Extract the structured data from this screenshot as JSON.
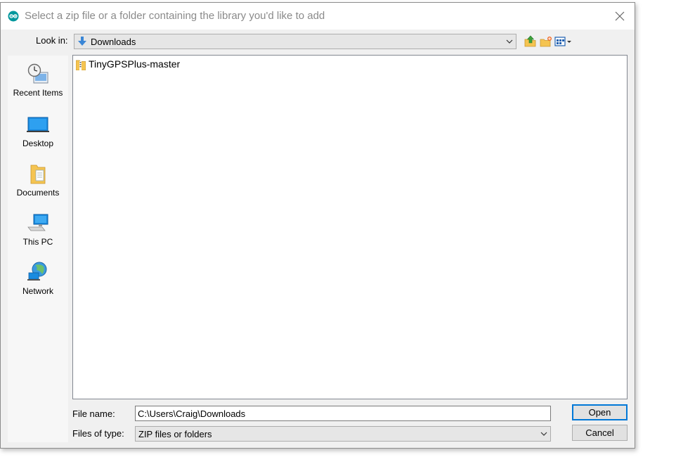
{
  "window": {
    "title": "Select a zip file or a folder containing the library you'd like to add"
  },
  "look_in": {
    "label": "Look in:",
    "value": "Downloads"
  },
  "toolbar": {
    "icons": [
      "up-folder-icon",
      "new-folder-icon",
      "view-menu-icon"
    ]
  },
  "places": [
    {
      "label": "Recent Items",
      "icon": "recent-items-icon"
    },
    {
      "label": "Desktop",
      "icon": "desktop-icon"
    },
    {
      "label": "Documents",
      "icon": "documents-icon"
    },
    {
      "label": "This PC",
      "icon": "this-pc-icon"
    },
    {
      "label": "Network",
      "icon": "network-icon"
    }
  ],
  "files": [
    {
      "name": "TinyGPSPlus-master",
      "icon": "zip-folder-icon"
    }
  ],
  "file_name": {
    "label": "File name:",
    "value": "C:\\Users\\Craig\\Downloads"
  },
  "file_type": {
    "label": "Files of type:",
    "value": "ZIP files or folders"
  },
  "buttons": {
    "open": "Open",
    "cancel": "Cancel"
  },
  "colors": {
    "accent": "#0078d7",
    "app_icon": "#00979c",
    "folder": "#f5c451"
  }
}
